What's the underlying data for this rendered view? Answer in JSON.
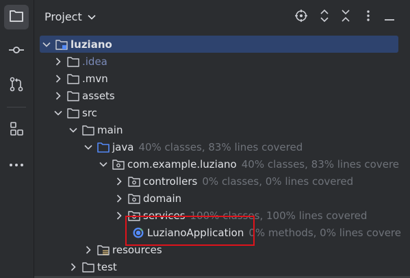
{
  "panel": {
    "title": "Project"
  },
  "activity_bar": [
    {
      "icon": "folder-icon",
      "active": true
    },
    {
      "icon": "commit-icon",
      "active": false
    },
    {
      "icon": "pull-requests-icon",
      "active": false
    },
    {
      "icon": "structure-icon",
      "active": false
    },
    {
      "icon": "more-icon",
      "active": false
    }
  ],
  "header_icons": [
    "locate-icon",
    "expand-all-icon",
    "collapse-all-icon",
    "options-icon",
    "hide-icon"
  ],
  "tree": {
    "root": {
      "label": "luziano"
    },
    "idea": {
      "label": ".idea"
    },
    "mvn": {
      "label": ".mvn"
    },
    "assets": {
      "label": "assets"
    },
    "src": {
      "label": "src"
    },
    "main": {
      "label": "main"
    },
    "java": {
      "label": "java",
      "coverage": "40% classes, 83% lines covered"
    },
    "package": {
      "label": "com.example.luziano",
      "coverage": "40% classes, 83% lines covere"
    },
    "controllers": {
      "label": "controllers",
      "coverage": "0% classes, 0% lines covered"
    },
    "domain": {
      "label": "domain",
      "coverage": ""
    },
    "services": {
      "label": "services",
      "coverage": "100% classes, 100% lines covered"
    },
    "app": {
      "label": "LuzianoApplication",
      "coverage": "0% methods, 0% lines covere"
    },
    "resources": {
      "label": "resources"
    },
    "test": {
      "label": "test"
    }
  },
  "colors": {
    "background": "#2b2d30",
    "selection": "#2e436e",
    "highlight": "#e0131b",
    "folder_blue": "#548af7"
  }
}
